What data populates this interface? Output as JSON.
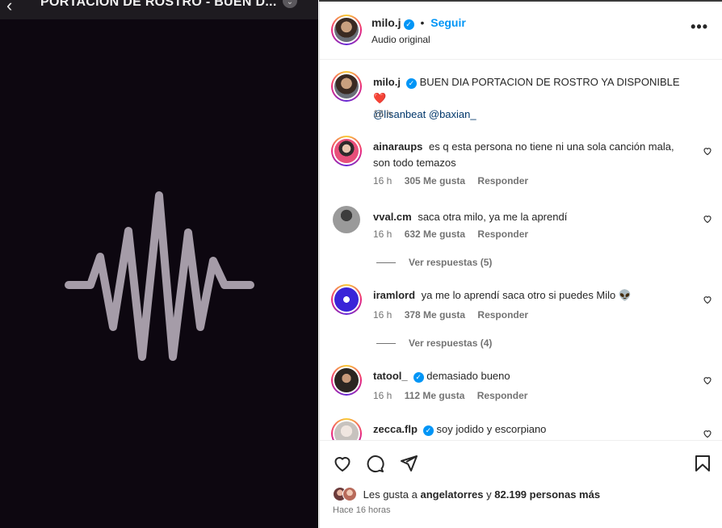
{
  "media": {
    "title": "PORTACION DE ROSTRO - BUEN D...",
    "back_icon": "chevron-left-icon",
    "more_icon": "chevron-down-icon",
    "background": "#0d0710",
    "waveform_color": "#a59ca8"
  },
  "header": {
    "username": "milo.j",
    "separator": "•",
    "follow_label": "Seguir",
    "subtitle": "Audio original",
    "more_icon": "more-horizontal-icon"
  },
  "caption": {
    "username": "milo.j",
    "text": "BUEN DIA PORTACION DE ROSTRO YA DISPONIBLE",
    "emoji": "❤️",
    "mentions": [
      "@lisanbeat",
      "@baxian_"
    ],
    "time": "16 h"
  },
  "comments": [
    {
      "username": "ainaraups",
      "verified": false,
      "text": "es q esta persona no tiene ni una sola canción mala, son todo temazos",
      "time": "16 h",
      "likes": "305 Me gusta",
      "reply": "Responder"
    },
    {
      "username": "vval.cm",
      "verified": false,
      "text": "saca otra milo, ya me la aprendí",
      "time": "16 h",
      "likes": "632 Me gusta",
      "reply": "Responder",
      "view_replies": "Ver respuestas (5)"
    },
    {
      "username": "iramlord",
      "verified": false,
      "text": "ya me lo aprendí saca otro si puedes Milo 👽",
      "time": "16 h",
      "likes": "378 Me gusta",
      "reply": "Responder",
      "view_replies": "Ver respuestas (4)"
    },
    {
      "username": "tatool_",
      "verified": true,
      "text": "demasiado bueno",
      "time": "16 h",
      "likes": "112 Me gusta",
      "reply": "Responder"
    },
    {
      "username": "zecca.flp",
      "verified": true,
      "text": "soy jodido y escorpiano"
    }
  ],
  "actions": {
    "like_icon": "heart-icon",
    "comment_icon": "comment-icon",
    "share_icon": "paper-plane-icon",
    "save_icon": "bookmark-icon"
  },
  "likes": {
    "prefix": "Les gusta a",
    "user": "angelatorres",
    "connector": "y",
    "others": "82.199 personas más"
  },
  "time_ago": "Hace 16 horas",
  "colors": {
    "accent": "#0095f6",
    "link": "#00376b",
    "muted": "#737373"
  }
}
